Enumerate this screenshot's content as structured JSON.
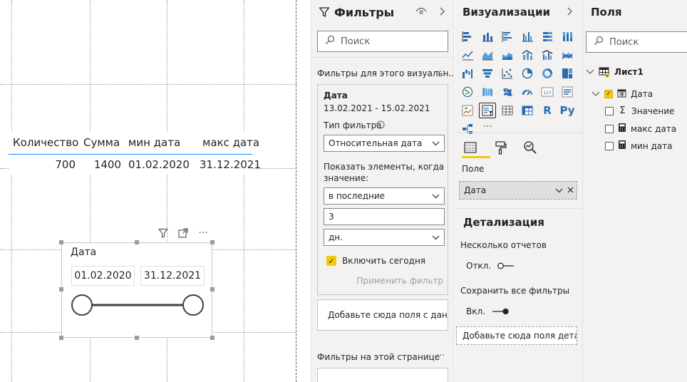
{
  "table": {
    "headers": [
      "Количество",
      "Сумма",
      "мин дата",
      "макс дата"
    ],
    "row": [
      "700",
      "1400",
      "01.02.2020",
      "31.12.2021"
    ]
  },
  "slicer": {
    "title": "Дата",
    "start": "01.02.2020",
    "end": "31.12.2021",
    "toolbar_more": "···"
  },
  "filters": {
    "title": "Фильтры",
    "search_placeholder": "Поиск",
    "visual_section": "Фильтры для этого визуальн...",
    "section_more": "···",
    "card": {
      "field": "Дата",
      "range": "13.02.2021 - 15.02.2021",
      "type_label": "Тип фильтра",
      "type_value": "Относительная дата",
      "show_label_1": "Показать элементы, когда",
      "show_label_2": "значение:",
      "condition": "в последние",
      "amount": "3",
      "unit": "дн.",
      "include_today": "Включить сегодня",
      "apply": "Применить фильтр"
    },
    "add_field": "Добавьте сюда поля с дан...",
    "page_section": "Фильтры на этой странице"
  },
  "viz": {
    "title": "Визуализации",
    "more": "···",
    "well_label": "Поле",
    "well_value": "Дата",
    "drill_title": "Детализация",
    "cross_report": "Несколько отчетов",
    "cross_state": "Откл.",
    "keep_filters": "Сохранить все фильтры",
    "keep_state": "Вкл.",
    "add_drill": "Добавьте сюда поля дета...",
    "r_label": "R",
    "py_label": "Py",
    "num_label": "123"
  },
  "fields": {
    "title": "Поля",
    "search_placeholder": "Поиск",
    "table_name": "Лист1",
    "items": [
      {
        "name": "Дата",
        "checked": true,
        "icon": "calendar-icon"
      },
      {
        "name": "Значение",
        "checked": false,
        "icon": "sigma-icon"
      },
      {
        "name": "макс дата",
        "checked": false,
        "icon": "calculator-icon"
      },
      {
        "name": "мин дата",
        "checked": false,
        "icon": "calculator-icon"
      }
    ]
  },
  "colors": {
    "accent_yellow": "#f2c80f",
    "table_rule": "#118dff",
    "pane_bg": "#f3f2f1"
  }
}
